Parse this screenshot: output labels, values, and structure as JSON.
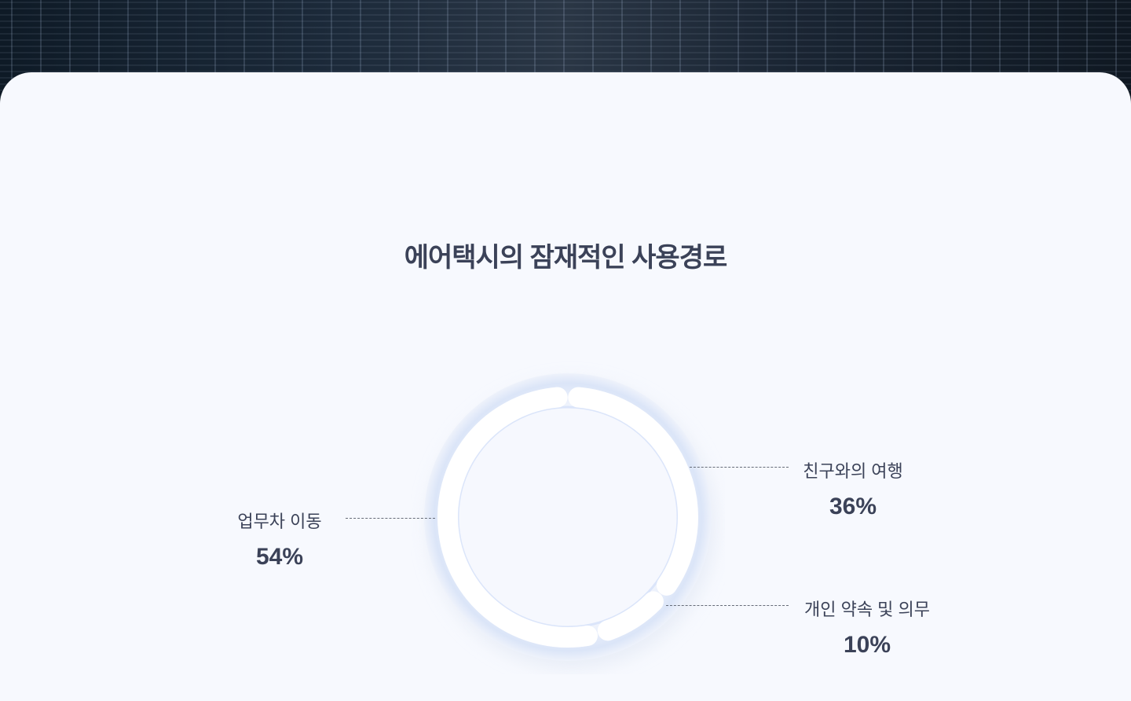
{
  "title": "에어택시의 잠재적인 사용경로",
  "chart_data": {
    "type": "pie",
    "title": "에어택시의 잠재적인 사용경로",
    "categories": [
      "친구와의 여행",
      "개인 약속 및 의무",
      "업무차 이동"
    ],
    "values": [
      36,
      10,
      54
    ],
    "labels": [
      "36%",
      "10%",
      "54%"
    ]
  }
}
